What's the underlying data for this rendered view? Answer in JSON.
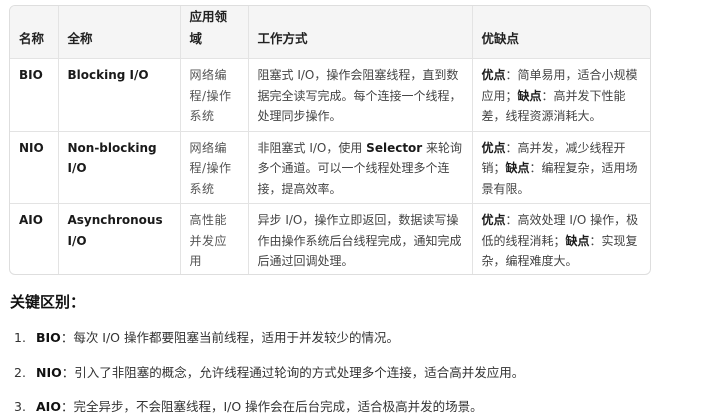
{
  "table": {
    "headers": [
      "名称",
      "全称",
      "应用领域",
      "工作方式",
      "优缺点"
    ],
    "rows": [
      {
        "name": "BIO",
        "full": "Blocking I/O",
        "domain": "网络编程/操作系统",
        "mode": "阻塞式 I/O，操作会阻塞线程，直到数据完全读写完成。每个连接一个线程，处理同步操作。",
        "pros_label": "优点",
        "pros": "：简单易用，适合小规模应用；",
        "cons_label": "缺点",
        "cons": "：高并发下性能差，线程资源消耗大。"
      },
      {
        "name": "NIO",
        "full": "Non-blocking I/O",
        "domain": "网络编程/操作系统",
        "mode_pre": "非阻塞式 I/O，使用 ",
        "mode_bold": "Selector",
        "mode_post": " 来轮询多个通道。可以一个线程处理多个连接，提高效率。",
        "pros_label": "优点",
        "pros": "：高并发，减少线程开销；",
        "cons_label": "缺点",
        "cons": "：编程复杂，适用场景有限。"
      },
      {
        "name": "AIO",
        "full": "Asynchronous I/O",
        "domain": "高性能并发应用",
        "mode": "异步 I/O，操作立即返回，数据读写操作由操作系统后台线程完成，通知完成后通过回调处理。",
        "pros_label": "优点",
        "pros": "：高效处理 I/O 操作，极低的线程消耗；",
        "cons_label": "缺点",
        "cons": "：实现复杂，编程难度大。"
      }
    ]
  },
  "section": {
    "title": "关键区别：",
    "items": [
      {
        "num": "1.",
        "term": "BIO",
        "text": "：每次 I/O 操作都要阻塞当前线程，适用于并发较少的情况。"
      },
      {
        "num": "2.",
        "term": "NIO",
        "text": "：引入了非阻塞的概念，允许线程通过轮询的方式处理多个连接，适合高并发应用。"
      },
      {
        "num": "3.",
        "term": "AIO",
        "text": "：完全异步，不会阻塞线程，I/O 操作会在后台完成，适合极高并发的场景。"
      }
    ]
  }
}
